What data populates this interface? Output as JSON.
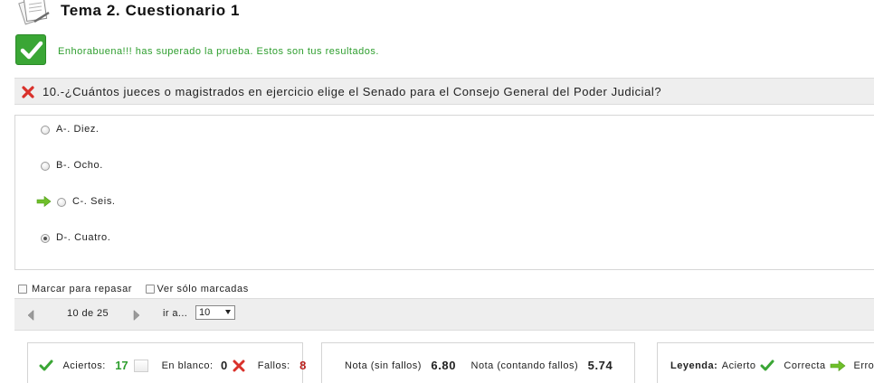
{
  "header": {
    "title": "Tema 2. Cuestionario 1",
    "logo_icon": "document-pencil-icon"
  },
  "result": {
    "message": "Enhorabuena!!! has superado la prueba. Estos son tus resultados.",
    "icon": "green-check-icon",
    "color": "#2e9e2e"
  },
  "question": {
    "status_icon": "red-x-icon",
    "text": "10.-¿Cuántos jueces o magistrados en ejercicio elige el Senado para el Consejo General del Poder Judicial?"
  },
  "answers": [
    {
      "label": "A-. Diez.",
      "selected": false,
      "correct": false
    },
    {
      "label": "B-. Ocho.",
      "selected": false,
      "correct": false
    },
    {
      "label": "C-. Seis.",
      "selected": false,
      "correct": true
    },
    {
      "label": "D-. Cuatro.",
      "selected": true,
      "correct": false
    }
  ],
  "marks": {
    "review_label": "Marcar para repasar",
    "only_marked_label": "Ver sólo marcadas"
  },
  "pager": {
    "counter": "10 de 25",
    "goto_label": "ir a...",
    "goto_value": "10"
  },
  "summary": {
    "aciertos_label": "Aciertos:",
    "aciertos_value": "17",
    "blanco_label": "En blanco:",
    "blanco_value": "0",
    "fallos_label": "Fallos:",
    "fallos_value": "8"
  },
  "grades": {
    "nota_sin_label": "Nota (sin fallos)",
    "nota_sin_value": "6.80",
    "nota_con_label": "Nota (contando fallos)",
    "nota_con_value": "5.74"
  },
  "legend": {
    "title": "Leyenda:",
    "acierto": "Acierto",
    "correcta": "Correcta",
    "error": "Error"
  },
  "colors": {
    "accent_green": "#3aa635",
    "error_red": "#b8201d",
    "bar_gray": "#eeeeee"
  }
}
